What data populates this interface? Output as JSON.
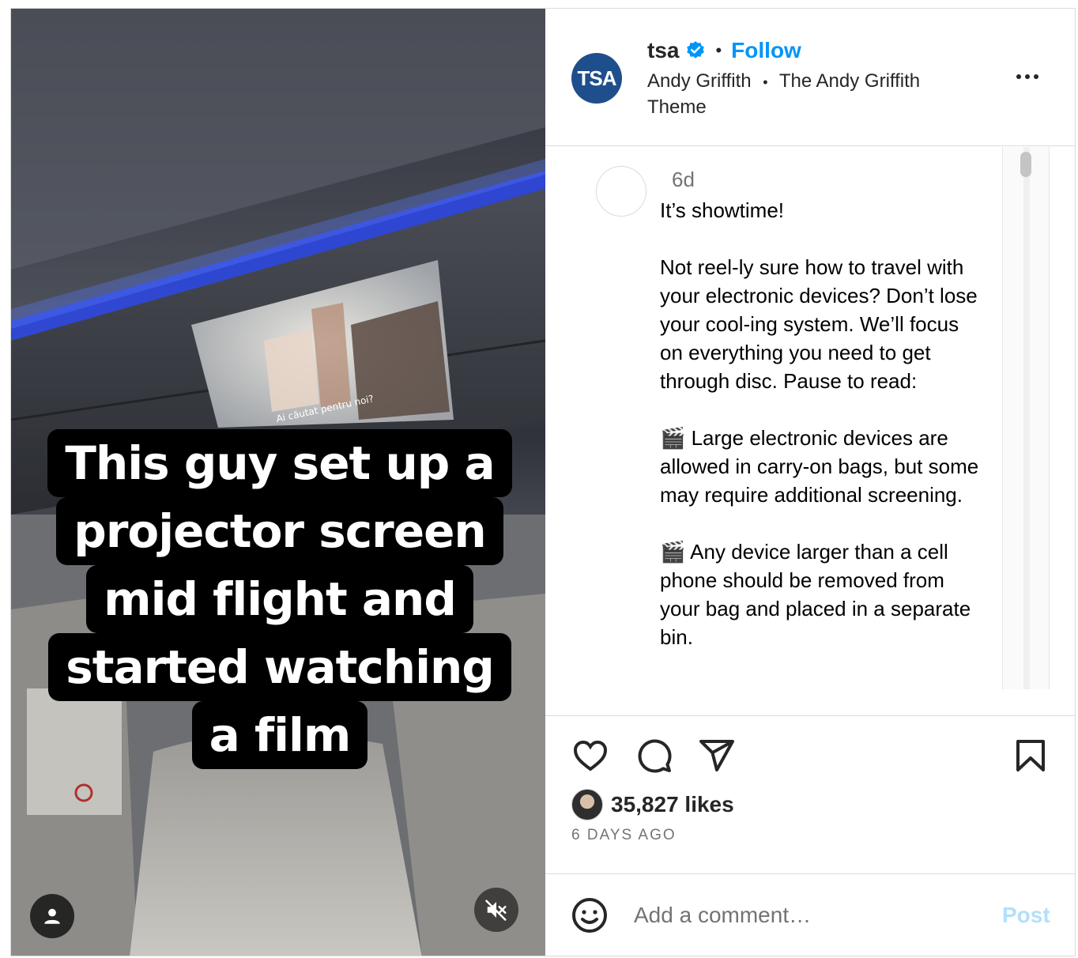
{
  "media": {
    "caption_lines": [
      "This guy set up a",
      "projector screen",
      "mid flight and",
      "started watching",
      "a film"
    ],
    "subtitle_overlay": "Ai căutat pentru noi?",
    "icons": {
      "user": "user-tag-icon",
      "mute": "muted-speaker-icon"
    }
  },
  "header": {
    "avatar_text": "TSA",
    "username": "tsa",
    "separator": "•",
    "follow_label": "Follow",
    "audio_artist": "Andy Griffith",
    "audio_title": "The Andy Griffith Theme",
    "more_icon": "more-horizontal-icon",
    "verified_color": "#0095f6"
  },
  "comment": {
    "time": "6d",
    "text": "It’s showtime!\n\nNot reel-ly sure how to travel with your electronic devices? Don’t lose your cool-ing system. We’ll focus on everything you need to get through disc. Pause to read:\n\n🎬 Large electronic devices are allowed in carry-on bags, but some may require additional screening.\n\n🎬 Any device larger than a cell phone should be removed from your bag and placed in a separate bin."
  },
  "actions": {
    "icons": [
      "heart-icon",
      "comment-icon",
      "share-icon",
      "bookmark-icon"
    ],
    "likes": "35,827 likes",
    "date": "6 DAYS AGO"
  },
  "comment_box": {
    "placeholder": "Add a comment…",
    "post_label": "Post",
    "post_color": "#b2dffc"
  }
}
